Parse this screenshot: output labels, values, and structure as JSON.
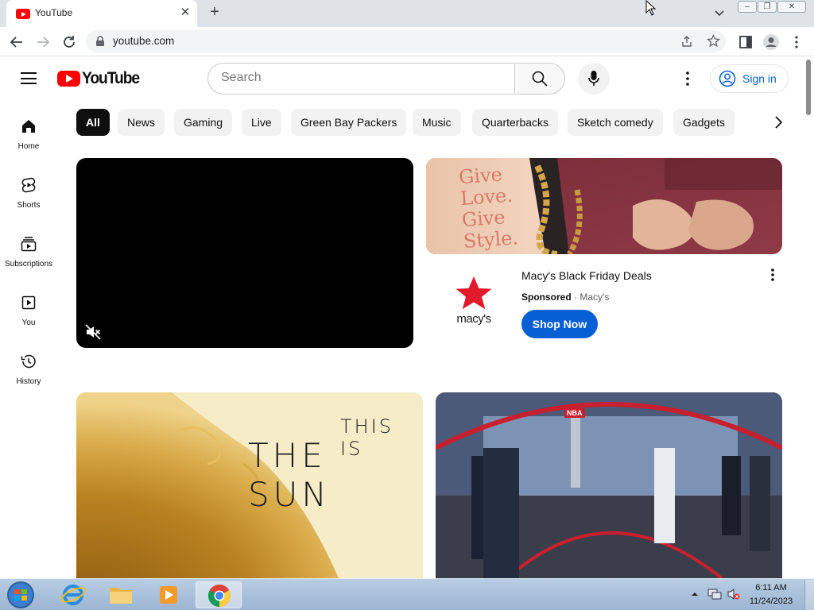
{
  "browser": {
    "tab": {
      "title": "YouTube",
      "close": "✕"
    },
    "new_tab": "+",
    "url": "youtube.com"
  },
  "masthead": {
    "logo_text": "YouTube",
    "search_placeholder": "Search",
    "sign_in": "Sign in"
  },
  "sidebar": {
    "items": [
      {
        "label": "Home",
        "icon": "home-icon"
      },
      {
        "label": "Shorts",
        "icon": "shorts-icon"
      },
      {
        "label": "Subscriptions",
        "icon": "subscriptions-icon"
      },
      {
        "label": "You",
        "icon": "you-icon"
      },
      {
        "label": "History",
        "icon": "history-icon"
      }
    ]
  },
  "chips": [
    "All",
    "News",
    "Gaming",
    "Live",
    "Green Bay Packers",
    "Music",
    "Quarterbacks",
    "Sketch comedy",
    "Gadgets"
  ],
  "ad": {
    "image_text": "Give Love. Give Style.",
    "title": "Macy's Black Friday Deals",
    "sponsored": "Sponsored",
    "advertiser": "Macy's",
    "logo_text": "macy's",
    "cta": "Shop Now"
  },
  "videos": [
    {
      "thumb_text_1": "THIS IS",
      "thumb_text_2": "THE SUN"
    },
    {
      "thumb_text_1": "NBA"
    }
  ],
  "taskbar": {
    "time": "6:11 AM",
    "date": "11/24/2023"
  },
  "colors": {
    "youtube_red": "#ff0000",
    "link_blue": "#065fd4",
    "macys_red": "#e21a2c"
  }
}
